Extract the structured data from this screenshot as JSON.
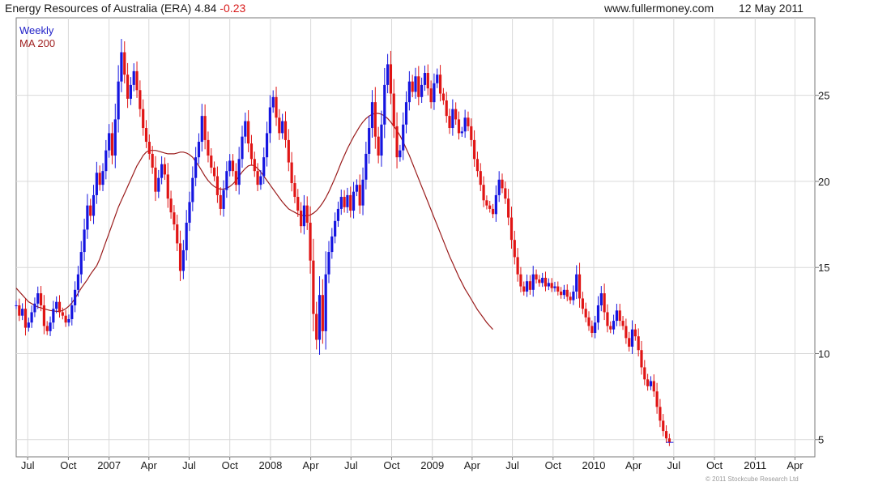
{
  "header": {
    "name": "Energy Resources of Australia (ERA)",
    "price": "4.84",
    "change": "-0.23",
    "site": "www.fullermoney.com",
    "date": "12 May 2011"
  },
  "legend": {
    "weekly": "Weekly",
    "ma": "MA 200"
  },
  "copyright": "© 2011 Stockcube Research Ltd",
  "colors": {
    "up": "#1515e0",
    "down": "#e01515",
    "ma": "#9a1c1c",
    "grid": "#d9d9d9",
    "frame": "#7a7a7a"
  },
  "chart_data": {
    "type": "candlestick",
    "frequency": "weekly",
    "x_range": [
      "2006-06-05",
      "2011-05-16"
    ],
    "y_axis": {
      "range": [
        4,
        29.5
      ],
      "ticks": [
        5,
        10,
        15,
        20,
        25
      ],
      "position": "right"
    },
    "x_ticks": [
      {
        "date": "2006-07-01",
        "label": "Jul"
      },
      {
        "date": "2006-10-01",
        "label": "Oct"
      },
      {
        "date": "2007-01-01",
        "label": "2007"
      },
      {
        "date": "2007-04-01",
        "label": "Apr"
      },
      {
        "date": "2007-07-01",
        "label": "Jul"
      },
      {
        "date": "2007-10-01",
        "label": "Oct"
      },
      {
        "date": "2008-01-01",
        "label": "2008"
      },
      {
        "date": "2008-04-01",
        "label": "Apr"
      },
      {
        "date": "2008-07-01",
        "label": "Jul"
      },
      {
        "date": "2008-10-01",
        "label": "Oct"
      },
      {
        "date": "2009-01-01",
        "label": "2009"
      },
      {
        "date": "2009-04-01",
        "label": "Apr"
      },
      {
        "date": "2009-07-01",
        "label": "Jul"
      },
      {
        "date": "2009-10-01",
        "label": "Oct"
      },
      {
        "date": "2010-01-01",
        "label": "2010"
      },
      {
        "date": "2010-04-01",
        "label": "Apr"
      },
      {
        "date": "2010-07-01",
        "label": "Jul"
      },
      {
        "date": "2010-10-01",
        "label": "Oct"
      },
      {
        "date": "2011-01-01",
        "label": "2011"
      },
      {
        "date": "2011-04-01",
        "label": "Apr"
      }
    ],
    "grid": true,
    "series": [
      {
        "name": "Weekly",
        "style": "candlestick",
        "start": "2006-06-05",
        "step_days": 7,
        "note": "weekly close prices; candle open = previous close",
        "close": [
          12.8,
          12.2,
          12.6,
          11.5,
          11.8,
          12.4,
          12.9,
          13.5,
          12.8,
          11.6,
          11.3,
          11.8,
          12.6,
          13.0,
          12.4,
          12.2,
          11.8,
          12.0,
          12.8,
          13.7,
          14.6,
          15.9,
          17.2,
          18.6,
          18.0,
          19.2,
          20.5,
          19.8,
          20.6,
          21.8,
          22.8,
          21.5,
          23.6,
          25.8,
          27.5,
          26.2,
          24.8,
          25.6,
          26.4,
          25.3,
          24.2,
          23.1,
          22.3,
          21.6,
          20.8,
          19.4,
          20.2,
          21.0,
          20.4,
          19.0,
          18.2,
          17.5,
          16.4,
          14.8,
          16.0,
          17.6,
          18.8,
          20.2,
          21.4,
          22.3,
          23.8,
          22.4,
          21.5,
          20.8,
          20.3,
          19.2,
          18.4,
          19.5,
          20.6,
          21.2,
          20.6,
          19.8,
          21.3,
          22.6,
          23.5,
          22.2,
          21.3,
          20.6,
          19.8,
          20.3,
          21.4,
          22.8,
          24.3,
          24.9,
          23.7,
          22.8,
          23.5,
          22.4,
          21.1,
          19.9,
          19.1,
          18.3,
          17.4,
          18.6,
          17.6,
          15.4,
          12.3,
          10.8,
          13.4,
          11.3,
          14.6,
          15.9,
          16.8,
          17.7,
          18.4,
          19.1,
          18.5,
          19.2,
          18.3,
          19.4,
          19.8,
          18.6,
          20.1,
          21.6,
          23.1,
          24.6,
          22.6,
          21.5,
          23.3,
          25.6,
          26.8,
          25.1,
          23.2,
          21.4,
          21.8,
          23.3,
          24.6,
          25.8,
          25.2,
          26.1,
          24.9,
          25.6,
          26.3,
          25.4,
          24.6,
          25.7,
          26.2,
          25.1,
          24.7,
          23.8,
          23.1,
          24.2,
          23.6,
          22.8,
          22.9,
          23.7,
          23.2,
          22.4,
          21.3,
          20.6,
          19.8,
          18.9,
          18.6,
          18.4,
          18.1,
          19.2,
          20.1,
          19.6,
          19.0,
          17.9,
          16.6,
          15.6,
          14.6,
          13.9,
          13.6,
          14.2,
          13.7,
          14.6,
          14.3,
          14.1,
          14.4,
          13.9,
          14.1,
          13.8,
          13.9,
          13.6,
          13.4,
          13.7,
          13.3,
          13.1,
          13.6,
          14.6,
          13.2,
          12.6,
          12.1,
          11.6,
          11.2,
          11.8,
          12.8,
          13.5,
          12.4,
          11.6,
          11.4,
          11.9,
          12.5,
          11.9,
          11.6,
          10.9,
          10.4,
          11.4,
          11.0,
          10.2,
          9.2,
          8.5,
          8.1,
          8.4,
          7.8,
          6.9,
          6.1,
          5.5,
          5.07,
          4.84
        ],
        "ma200": [
          13.8,
          13.6,
          13.4,
          13.2,
          13.0,
          12.9,
          12.8,
          12.7,
          12.65,
          12.6,
          12.55,
          12.5,
          12.48,
          12.45,
          12.45,
          12.5,
          12.6,
          12.75,
          12.95,
          13.2,
          13.5,
          13.8,
          14.05,
          14.3,
          14.6,
          14.85,
          15.1,
          15.5,
          16.0,
          16.5,
          17.0,
          17.5,
          18.0,
          18.5,
          18.9,
          19.3,
          19.7,
          20.1,
          20.5,
          20.9,
          21.2,
          21.5,
          21.7,
          21.8,
          21.8,
          21.8,
          21.75,
          21.7,
          21.65,
          21.6,
          21.6,
          21.6,
          21.65,
          21.7,
          21.7,
          21.65,
          21.55,
          21.4,
          21.15,
          20.9,
          20.6,
          20.3,
          20.05,
          19.85,
          19.7,
          19.6,
          19.55,
          19.55,
          19.6,
          19.7,
          19.85,
          20.05,
          20.3,
          20.55,
          20.75,
          20.9,
          20.95,
          20.9,
          20.75,
          20.55,
          20.3,
          20.05,
          19.8,
          19.55,
          19.3,
          19.05,
          18.8,
          18.6,
          18.4,
          18.3,
          18.2,
          18.1,
          18.05,
          18.0,
          18.0,
          18.05,
          18.15,
          18.3,
          18.5,
          18.75,
          19.05,
          19.4,
          19.8,
          20.2,
          20.65,
          21.1,
          21.5,
          21.9,
          22.25,
          22.6,
          22.9,
          23.2,
          23.45,
          23.65,
          23.8,
          23.9,
          23.95,
          23.95,
          23.9,
          23.8,
          23.65,
          23.45,
          23.2,
          22.95,
          22.65,
          22.3,
          21.9,
          21.5,
          21.05,
          20.6,
          20.15,
          19.7,
          19.25,
          18.8,
          18.35,
          17.9,
          17.45,
          17.0,
          16.55,
          16.1,
          15.65,
          15.25,
          14.85,
          14.45,
          14.1,
          13.75,
          13.45,
          13.15,
          12.85,
          12.55,
          12.3,
          12.05,
          11.8,
          11.6,
          11.4
        ]
      }
    ]
  }
}
